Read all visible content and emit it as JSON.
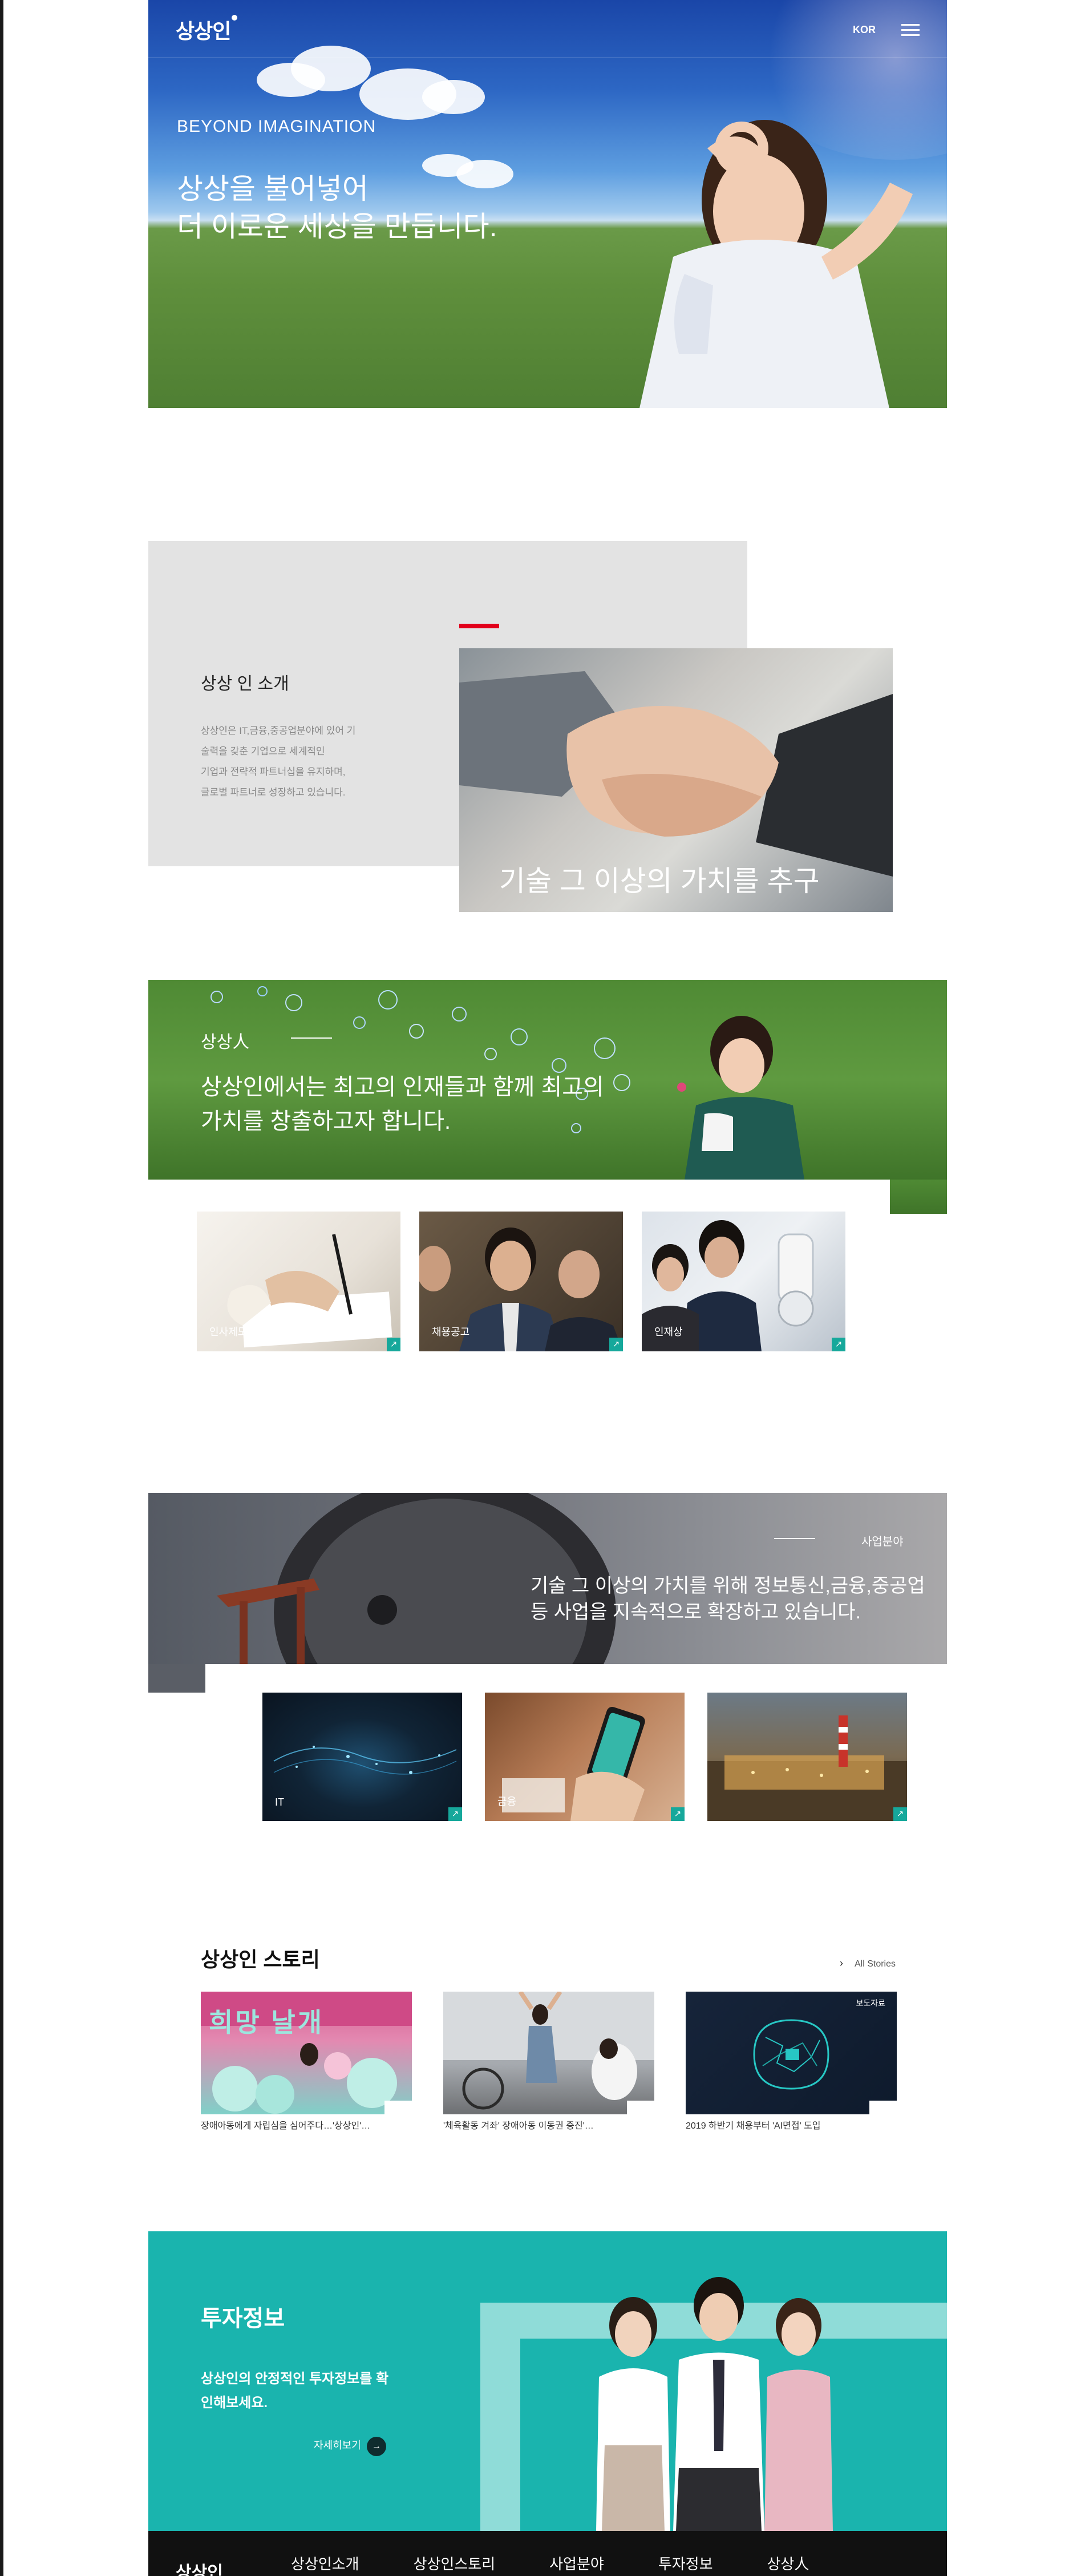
{
  "header": {
    "logo": "상상인",
    "lang": "KOR",
    "menu_icon": "hamburger-icon"
  },
  "hero": {
    "eyebrow": "BEYOND IMAGINATION",
    "headline_line1": "상상을 불어넣어",
    "headline_line2": "더 이로운 세상을 만듭니다."
  },
  "intro": {
    "title": "상상 인 소개",
    "desc_lines": [
      "상상인은 IT,금융,중공업분야에 있어 기",
      "술력을 갖춘 기업으로 세계적인",
      "기업과 전략적 파트너십을 유지하며,",
      "글로벌 파트너로 성장하고 있습니다."
    ],
    "caption": "기술 그 이상의 가치를 추구",
    "accent": "#e2001a"
  },
  "people": {
    "label": "상상人",
    "text": "상상인에서는 최고의 인재들과 함께 최고의 가치를 창출하고자 합니다.",
    "cards": [
      {
        "label": "인사제도"
      },
      {
        "label": "채용공고"
      },
      {
        "label": "인재상"
      }
    ]
  },
  "business": {
    "label": "사업분야",
    "text": "기술 그 이상의 가치를 위해 정보통신,금융,중공업 등 사업을 지속적으로 확장하고 있습니다.",
    "cards": [
      {
        "label": "IT"
      },
      {
        "label": "금융"
      },
      {
        "label": ""
      }
    ]
  },
  "story": {
    "title": "상상인 스토리",
    "all_label": "All Stories",
    "cards": [
      {
        "caption": "장애아동에게 자립심을 심어주다…'상상인'…",
        "badge": "",
        "banner_text": "희망 날개"
      },
      {
        "caption": "'체육활동 겨좌' 장애아동 이동권 증진'…",
        "badge": ""
      },
      {
        "caption": "2019 하반기 채용부터 'AI면접' 도입",
        "badge": "보도자료"
      }
    ]
  },
  "ir": {
    "title": "투자정보",
    "desc_line1": "상상인의 안정적인 투자정보를 확",
    "desc_line2": "인해보세요.",
    "more_label": "자세히보기",
    "color": "#1ab4ae"
  },
  "footer": {
    "logo": "상상인",
    "nav": [
      "상상인소개",
      "상상인스토리",
      "사업분야",
      "투자정보",
      "상상人"
    ]
  }
}
